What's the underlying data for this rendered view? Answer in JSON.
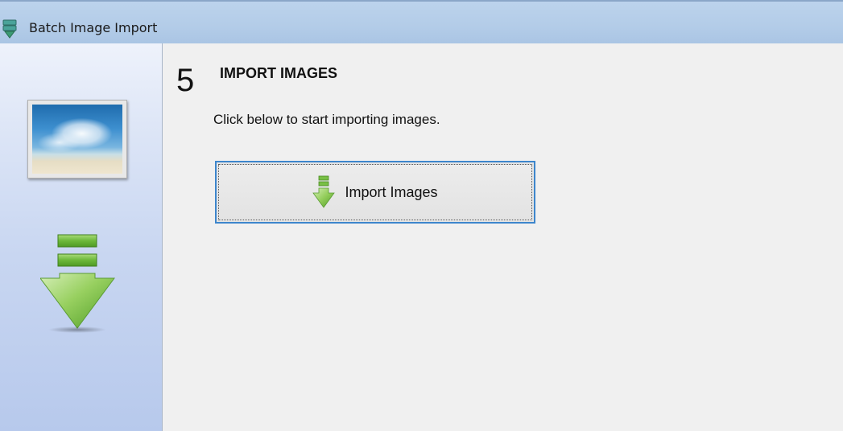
{
  "window": {
    "title": "Batch Image Import",
    "app_icon": "batch-import-icon"
  },
  "sidebar": {
    "photo_icon": "landscape-photo-icon",
    "arrow_icon": "green-download-arrow-icon"
  },
  "step": {
    "number": "5",
    "title": "IMPORT IMAGES",
    "instruction": "Click below to start importing images."
  },
  "import_button": {
    "label": "Import Images",
    "icon": "green-download-arrow-icon",
    "focus_color": "#3d86cc"
  },
  "colors": {
    "titlebar": "#b3cce8",
    "sidebar_top": "#eef2fb",
    "sidebar_bottom": "#b7c9ec",
    "content_bg": "#f0f0f0",
    "arrow_green": "#7cc242"
  }
}
